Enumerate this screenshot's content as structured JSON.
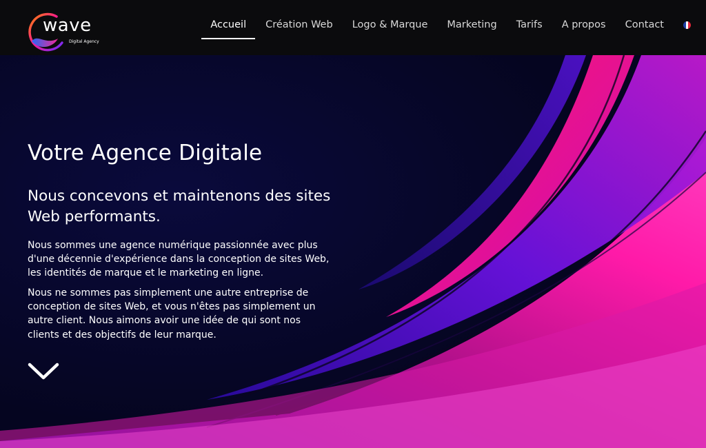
{
  "brand": {
    "name": "wave",
    "tagline": "Digital Agency"
  },
  "nav": {
    "items": [
      {
        "label": "Accueil",
        "active": true
      },
      {
        "label": "Création Web",
        "active": false
      },
      {
        "label": "Logo & Marque",
        "active": false
      },
      {
        "label": "Marketing",
        "active": false
      },
      {
        "label": "Tarifs",
        "active": false
      },
      {
        "label": "A propos",
        "active": false
      },
      {
        "label": "Contact",
        "active": false
      }
    ],
    "language_icon": "french-flag-icon"
  },
  "hero": {
    "title": "Votre Agence Digitale",
    "subtitle": "Nous concevons et maintenons des sites Web performants.",
    "paragraph1": "Nous sommes une agence numérique passionnée avec plus d'une décennie d'expérience dans la conception de sites Web, les identités de marque et le marketing en ligne.",
    "paragraph2": "Nous ne sommes pas simplement une autre entreprise de conception de sites Web, et vous n'êtes pas simplement un autre client. Nous aimons avoir une idée de qui sont nos clients et des objectifs de leur marque.",
    "scroll_icon": "chevron-down-icon"
  },
  "colors": {
    "header_bg": "#0b0b0d",
    "hero_dark": "#07072a",
    "accent_magenta": "#ff1aa8",
    "accent_purple": "#7a10e0",
    "flag_blue": "#1f3fa6",
    "flag_white": "#ffffff",
    "flag_red": "#e6273a"
  }
}
